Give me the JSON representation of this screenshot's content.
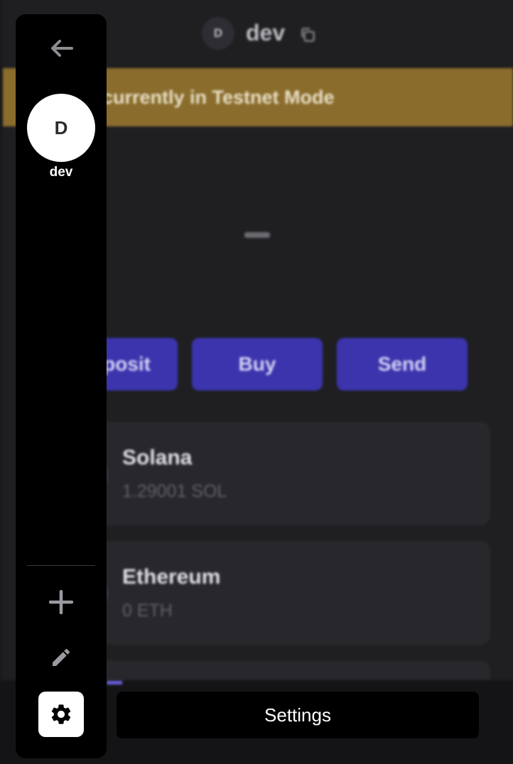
{
  "wallet": {
    "avatar_initial": "D",
    "username": "dev",
    "testnet_banner": "currently in Testnet Mode",
    "actions": {
      "deposit": "posit",
      "buy": "Buy",
      "send": "Send"
    },
    "tokens": [
      {
        "name": "Solana",
        "amount": "1.29001 SOL"
      },
      {
        "name": "Ethereum",
        "amount": "0 ETH"
      }
    ]
  },
  "drawer": {
    "avatar_initial": "D",
    "username": "dev"
  },
  "tooltip": {
    "label": "Settings"
  },
  "colors": {
    "drawer_bg": "#000000",
    "banner": "#8a6d2c",
    "action_button": "#3b34ad",
    "card": "#28282c"
  },
  "icons": [
    "copy-icon",
    "arrow-left-icon",
    "plus-icon",
    "pencil-icon",
    "gear-icon"
  ]
}
